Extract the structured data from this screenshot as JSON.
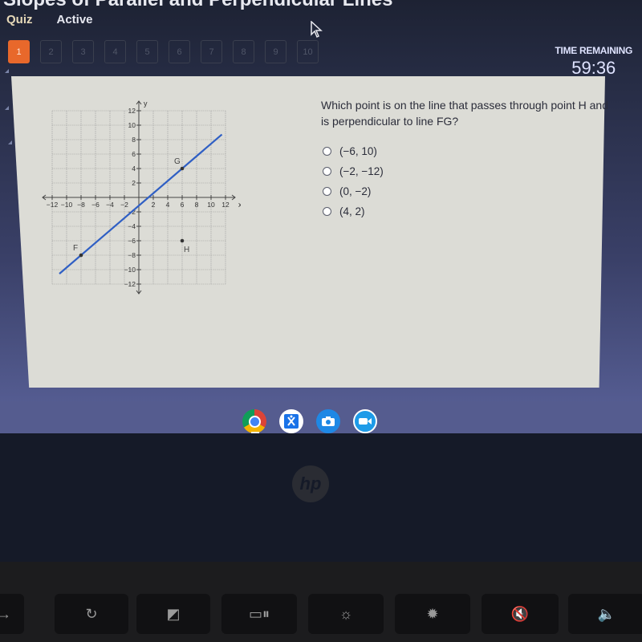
{
  "page": {
    "title": "Slopes of Parallel and Perpendicular Lines",
    "nav": {
      "quiz_label": "Quiz",
      "status_label": "Active"
    }
  },
  "question_numbers": [
    {
      "label": "1",
      "current": true
    },
    {
      "label": "2",
      "current": false
    },
    {
      "label": "3",
      "current": false
    },
    {
      "label": "4",
      "current": false
    },
    {
      "label": "5",
      "current": false
    },
    {
      "label": "6",
      "current": false
    },
    {
      "label": "7",
      "current": false
    },
    {
      "label": "8",
      "current": false
    },
    {
      "label": "9",
      "current": false
    },
    {
      "label": "10",
      "current": false
    }
  ],
  "timer": {
    "label": "TIME REMAINING",
    "value": "59:36"
  },
  "question": {
    "text": "Which point is on the line that passes through point H and is perpendicular to line FG?",
    "options": [
      {
        "label": "(−6, 10)",
        "selected": false
      },
      {
        "label": "(−2, −12)",
        "selected": false
      },
      {
        "label": "(0, −2)",
        "selected": false
      },
      {
        "label": "(4, 2)",
        "selected": false
      }
    ]
  },
  "graph": {
    "x_label": "x",
    "y_label": "y",
    "x_range": [
      -12,
      12
    ],
    "y_range": [
      -12,
      12
    ],
    "grid_step": 2,
    "x_ticks": [
      "-12",
      "-10",
      "-8",
      "-6",
      "-4",
      "-2",
      "2",
      "4",
      "6",
      "8",
      "10",
      "12"
    ],
    "y_ticks": [
      "12",
      "10",
      "8",
      "6",
      "4",
      "2",
      "-2",
      "-4",
      "-6",
      "-8",
      "-10",
      "-12"
    ],
    "line_color": "#2f5fc4",
    "line_fg": {
      "through": [
        [
          -8,
          -8
        ],
        [
          6,
          4
        ]
      ]
    },
    "points": [
      {
        "name": "G",
        "x": 6,
        "y": 4
      },
      {
        "name": "F",
        "x": -8,
        "y": -8
      },
      {
        "name": "H",
        "x": 6,
        "y": -6
      }
    ]
  },
  "shelf": [
    {
      "name": "chrome",
      "color": "#4285f4"
    },
    {
      "name": "classroom-app",
      "color": "#1a73e8"
    },
    {
      "name": "camera",
      "color": "#1e88e5"
    },
    {
      "name": "video-call",
      "color": "#1e9be8"
    }
  ],
  "brand": "hp",
  "colors": {
    "accent": "#e8682b",
    "panel": "#dcdcd6",
    "taskbar": "#555c8f"
  }
}
